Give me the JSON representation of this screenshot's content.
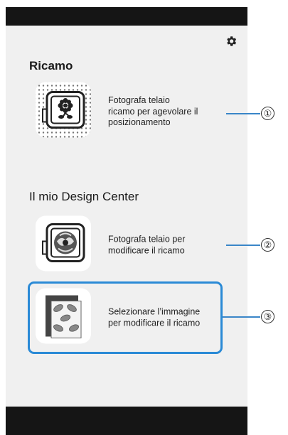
{
  "screen": {
    "sections": [
      {
        "title": "Ricamo"
      },
      {
        "title": "Il mio Design Center"
      }
    ],
    "items": [
      {
        "label_lines": [
          "Fotografa telaio",
          "ricamo per agevolare il",
          "posizionamento"
        ],
        "callout": "①"
      },
      {
        "label_lines": [
          "Fotografa telaio per",
          "modificare il ricamo"
        ],
        "callout": "②"
      },
      {
        "label_lines": [
          "Selezionare l’immagine",
          "per modificare il ricamo"
        ],
        "callout": "③"
      }
    ]
  },
  "icons": {
    "settings": "gear-icon",
    "item1": "hoop-flower-icon",
    "item2": "hoop-pattern-icon",
    "item3": "image-leaves-icon"
  },
  "colors": {
    "highlight": "#2a8ad6",
    "callout_line": "#3a86c8"
  }
}
